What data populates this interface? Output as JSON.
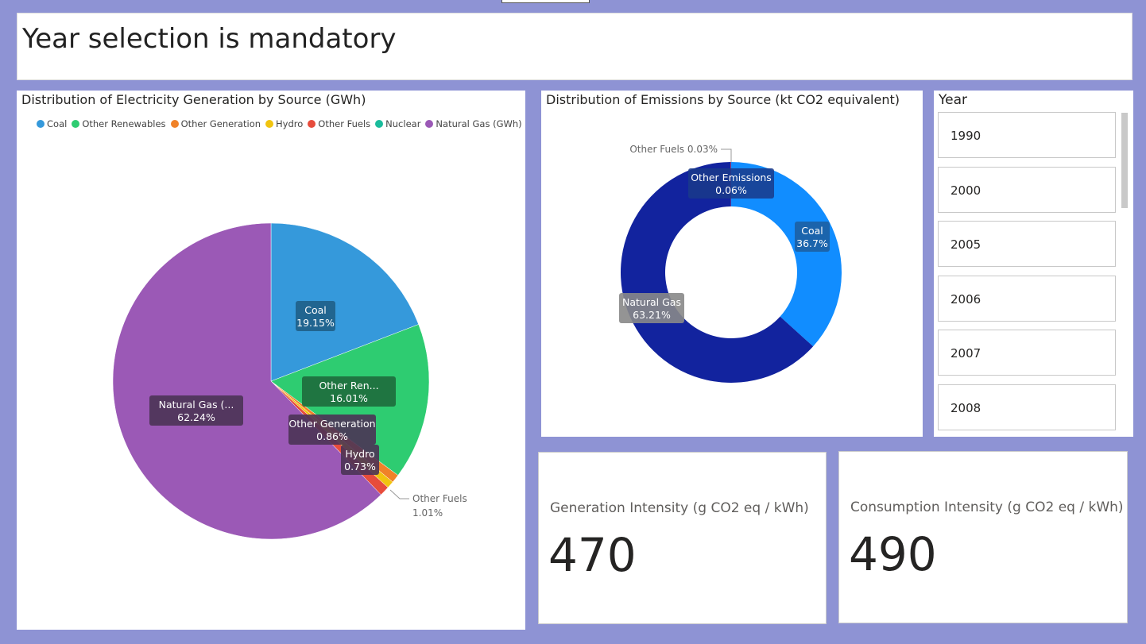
{
  "header": {
    "title": "Year selection is mandatory"
  },
  "generation_chart": {
    "title": "Distribution of Electricity Generation by Source (GWh)",
    "legend": [
      {
        "label": "Coal",
        "color": "#3599db"
      },
      {
        "label": "Other Renewables",
        "color": "#2ecc71"
      },
      {
        "label": "Other Generation",
        "color": "#f08228"
      },
      {
        "label": "Hydro",
        "color": "#f1c40f"
      },
      {
        "label": "Other Fuels",
        "color": "#e74c3c"
      },
      {
        "label": "Nuclear",
        "color": "#1abc9c"
      },
      {
        "label": "Natural Gas (GWh)",
        "color": "#9b59b6"
      }
    ],
    "labels": {
      "coal": [
        "Coal",
        "19.15%"
      ],
      "renew": [
        "Other Ren...",
        "16.01%"
      ],
      "othergen": [
        "Other Generation",
        "0.86%"
      ],
      "hydro": [
        "Hydro",
        "0.73%"
      ],
      "otherfuels": [
        "Other Fuels",
        "1.01%"
      ],
      "gas": [
        "Natural Gas (...",
        "62.24%"
      ]
    }
  },
  "emissions_chart": {
    "title": "Distribution of Emissions by Source (kt CO2 equivalent)",
    "labels": {
      "otherfuels": "Other Fuels 0.03%",
      "otheremissions": [
        "Other Emissions",
        "0.06%"
      ],
      "coal": [
        "Coal",
        "36.7%"
      ],
      "gas": [
        "Natural Gas",
        "63.21%"
      ]
    }
  },
  "chart_data": [
    {
      "type": "pie",
      "title": "Distribution of Electricity Generation by Source (GWh)",
      "categories": [
        "Coal",
        "Other Renewables",
        "Other Generation",
        "Hydro",
        "Other Fuels",
        "Nuclear",
        "Natural Gas (GWh)"
      ],
      "values": [
        19.15,
        16.01,
        0.86,
        0.73,
        1.01,
        0.0,
        62.24
      ],
      "colors": [
        "#3599db",
        "#2ecc71",
        "#f08228",
        "#f1c40f",
        "#e74c3c",
        "#1abc9c",
        "#9b59b6"
      ],
      "legend_position": "top-left"
    },
    {
      "type": "pie",
      "title": "Distribution of Emissions by Source (kt CO2 equivalent)",
      "categories": [
        "Coal",
        "Natural Gas",
        "Other Fuels",
        "Other Emissions"
      ],
      "values": [
        36.7,
        63.21,
        0.03,
        0.06
      ],
      "colors": [
        "#118dff",
        "#12239e",
        "#e66c37",
        "#6b007b"
      ]
    }
  ],
  "year_slicer": {
    "title": "Year",
    "years": [
      "1990",
      "2000",
      "2005",
      "2006",
      "2007",
      "2008"
    ]
  },
  "kpis": {
    "generation": {
      "label": "Generation Intensity (g CO2 eq / kWh)",
      "value": "470"
    },
    "consumption": {
      "label": "Consumption Intensity (g CO2 eq / kWh)",
      "value": "490"
    }
  }
}
